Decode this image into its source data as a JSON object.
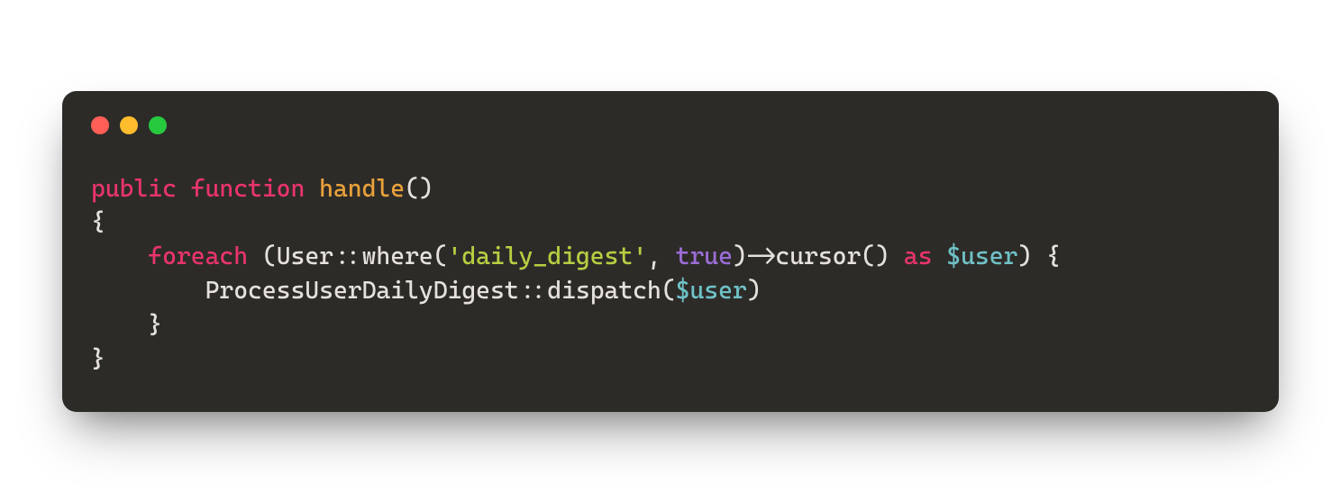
{
  "colors": {
    "window_bg": "#2d2b28",
    "dot_red": "#ff5f56",
    "dot_yellow": "#ffbd2e",
    "dot_green": "#27c93f",
    "keyword": "#e8346c",
    "funcname": "#e9a13b",
    "string": "#b7ce42",
    "boolean": "#9b6dd7",
    "variable": "#6fc2c7",
    "default": "#e6e1dc"
  },
  "code": {
    "line1": {
      "kw_public": "public",
      "sp1": " ",
      "kw_function": "function",
      "sp2": " ",
      "fn_name": "handle",
      "parens": "()"
    },
    "line2": {
      "brace_open": "{"
    },
    "line3": {
      "indent": "    ",
      "kw_foreach": "foreach",
      "sp1": " ",
      "paren_open": "(",
      "class_call": "User::where(",
      "str_arg": "'daily_digest'",
      "comma": ", ",
      "bool_arg": "true",
      "after_bool": ")->cursor() ",
      "kw_as": "as",
      "sp2": " ",
      "var_user": "$user",
      "tail": ") {"
    },
    "line4": {
      "indent": "        ",
      "call": "ProcessUserDailyDigest::dispatch(",
      "var_user": "$user",
      "close": ")"
    },
    "line5": {
      "indent": "    ",
      "brace_close": "}"
    },
    "line6": {
      "brace_close": "}"
    }
  }
}
